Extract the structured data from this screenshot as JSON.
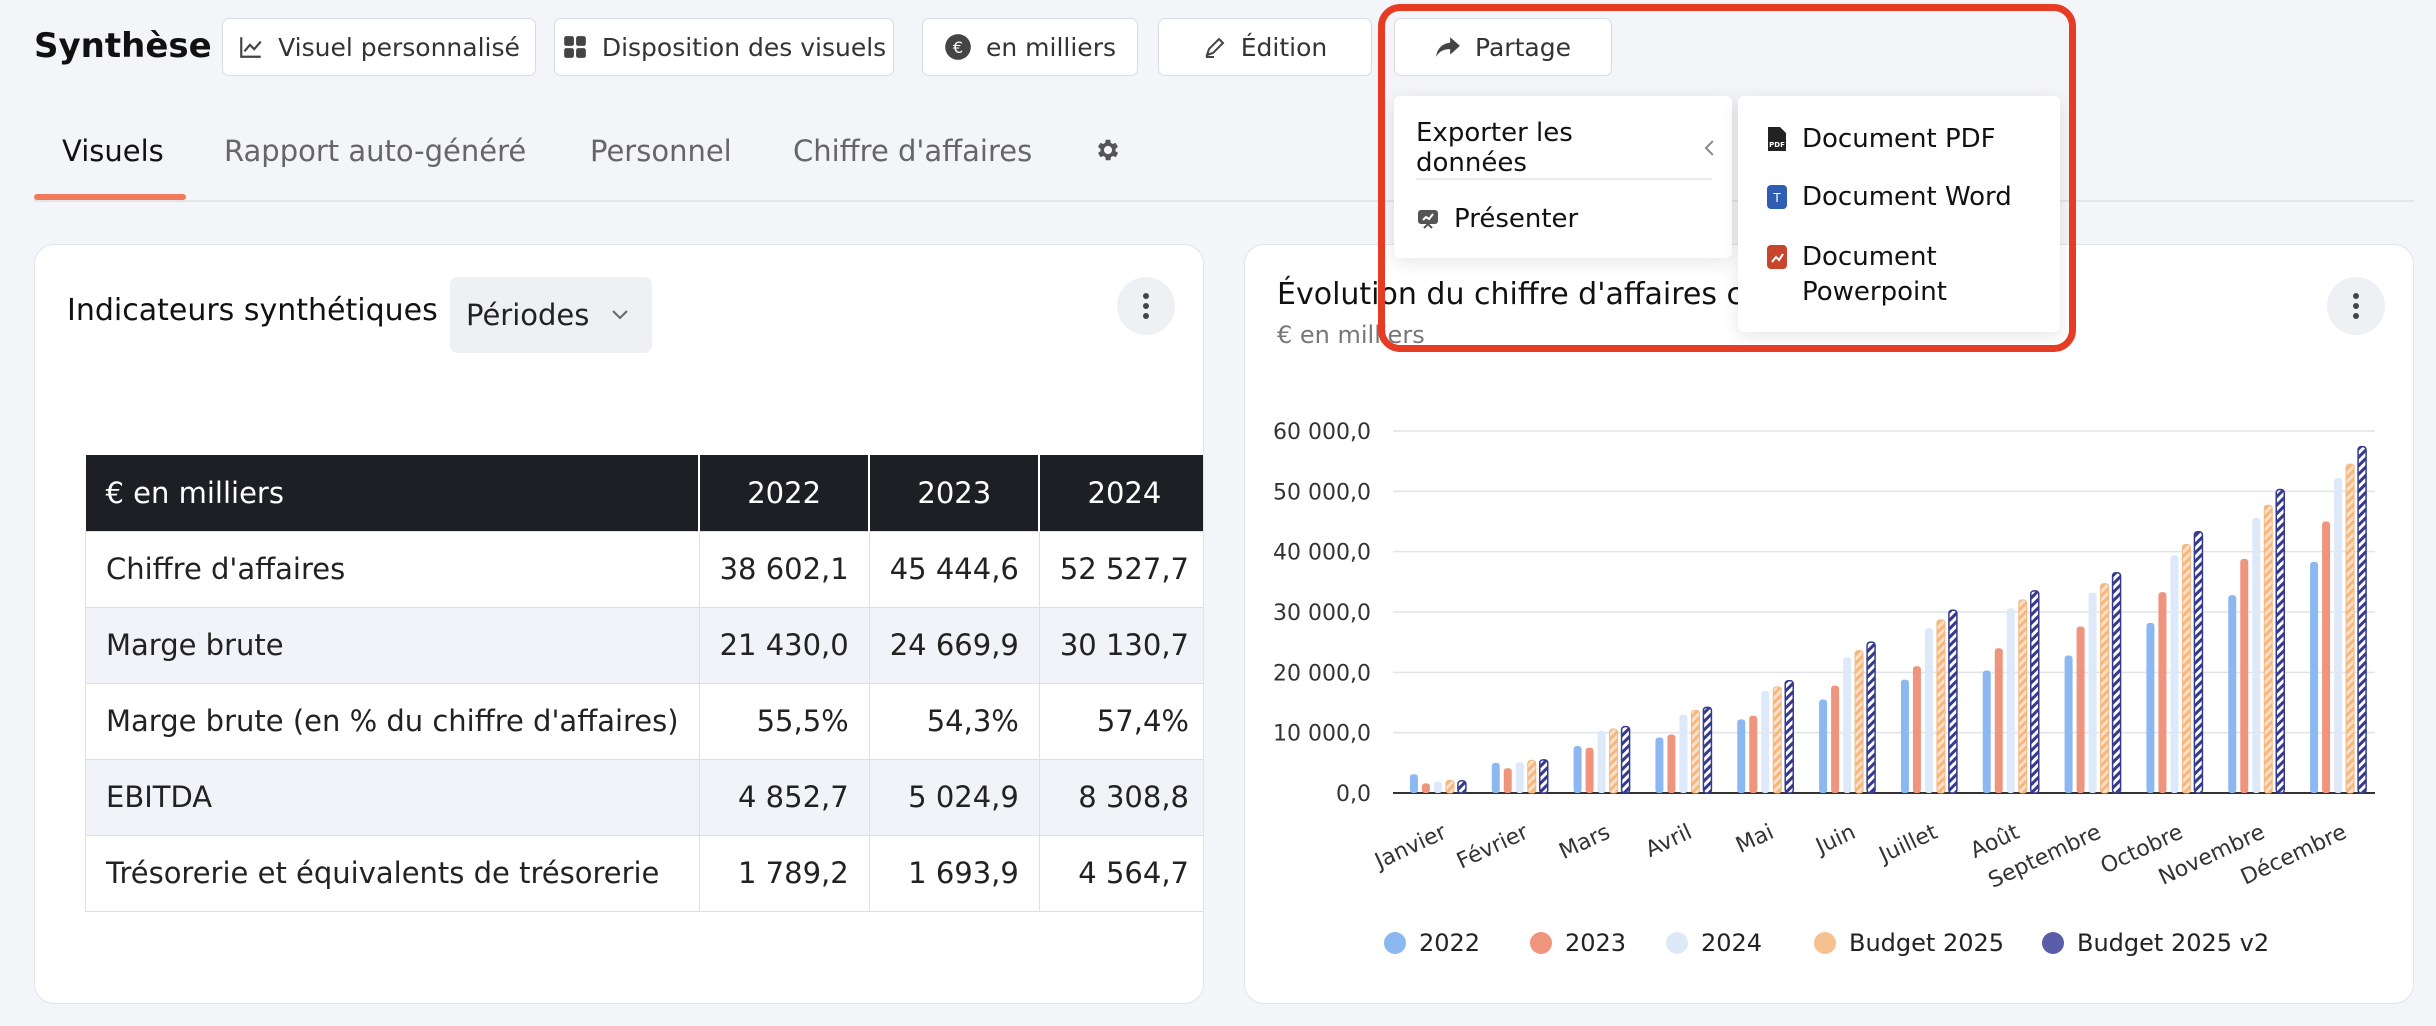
{
  "header": {
    "title": "Synthèse",
    "buttons": {
      "custom_visual": "Visuel personnalisé",
      "layout": "Disposition des visuels",
      "units": "en milliers",
      "edit": "Édition",
      "share": "Partage"
    }
  },
  "tabs": [
    "Visuels",
    "Rapport auto-généré",
    "Personnel",
    "Chiffre d'affaires"
  ],
  "share_menu": {
    "export_data": "Exporter les données",
    "present": "Présenter",
    "export_options": [
      "Document PDF",
      "Document Word",
      "Document Powerpoint"
    ]
  },
  "kpi_card": {
    "title": "Indicateurs synthétiques",
    "period_select": "Périodes",
    "table": {
      "header": [
        "€ en milliers",
        "2022",
        "2023",
        "2024"
      ],
      "rows": [
        [
          "Chiffre d'affaires",
          "38 602,1",
          "45 444,6",
          "52 527,7"
        ],
        [
          "Marge brute",
          "21 430,0",
          "24 669,9",
          "30 130,7"
        ],
        [
          "Marge brute (en % du chiffre d'affaires)",
          "55,5%",
          "54,3%",
          "57,4%"
        ],
        [
          "EBITDA",
          "4 852,7",
          "5 024,9",
          "8 308,8"
        ],
        [
          "Trésorerie et équivalents de trésorerie",
          "1 789,2",
          "1 693,9",
          "4 564,7"
        ]
      ]
    }
  },
  "chart_card": {
    "title": "Évolution du chiffre d'affaires cum",
    "subtitle": "€ en milliers"
  },
  "chart_data": {
    "type": "bar",
    "title": "Évolution du chiffre d'affaires cum",
    "subtitle": "€ en milliers",
    "categories": [
      "Janvier",
      "Février",
      "Mars",
      "Avril",
      "Mai",
      "Juin",
      "Juillet",
      "Août",
      "Septembre",
      "Octobre",
      "Novembre",
      "Décembre"
    ],
    "ylim": [
      0,
      60000
    ],
    "yticks": [
      "0,0",
      "10 000,0",
      "20 000,0",
      "30 000,0",
      "40 000,0",
      "50 000,0",
      "60 000,0"
    ],
    "grid": true,
    "legend_position": "bottom",
    "series": [
      {
        "name": "2022",
        "color": "#8bb8f0",
        "values": [
          3100,
          5000,
          7800,
          9200,
          12200,
          15500,
          18800,
          20300,
          22800,
          28200,
          32800,
          38300
        ]
      },
      {
        "name": "2023",
        "color": "#f0957d",
        "values": [
          1600,
          4100,
          7500,
          9700,
          12800,
          17800,
          21000,
          24000,
          27600,
          33300,
          38800,
          45000
        ]
      },
      {
        "name": "2024",
        "color": "#dde9f8",
        "values": [
          1900,
          5100,
          10300,
          13000,
          16900,
          22500,
          27300,
          30600,
          33200,
          39400,
          45600,
          52200
        ]
      },
      {
        "name": "Budget 2025",
        "color": "#f7c08f",
        "values": [
          2100,
          5400,
          10600,
          13700,
          17600,
          23600,
          28700,
          32000,
          34700,
          41200,
          47700,
          54500
        ]
      },
      {
        "name": "Budget 2025 v2",
        "color": "#3b3f94",
        "values": [
          2000,
          5500,
          11000,
          14200,
          18600,
          25000,
          30300,
          33500,
          36500,
          43300,
          50300,
          57400
        ]
      }
    ]
  }
}
